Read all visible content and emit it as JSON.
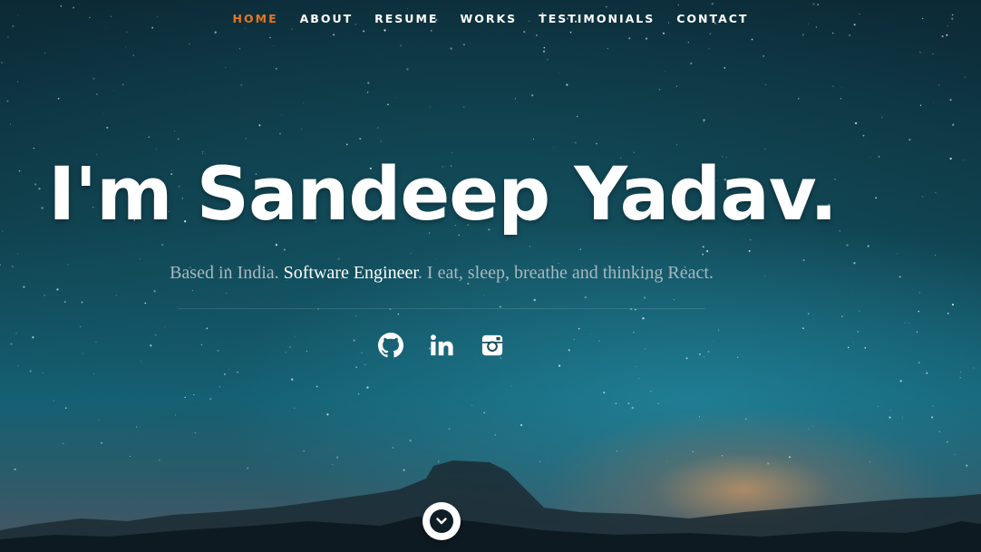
{
  "nav": {
    "items": [
      {
        "label": "HOME",
        "active": true
      },
      {
        "label": "ABOUT",
        "active": false
      },
      {
        "label": "RESUME",
        "active": false
      },
      {
        "label": "WORKS",
        "active": false
      },
      {
        "label": "TESTIMONIALS",
        "active": false
      },
      {
        "label": "CONTACT",
        "active": false
      }
    ],
    "active_color": "#e8741f"
  },
  "hero": {
    "headline": "I'm Sandeep Yadav.",
    "tagline": {
      "prefix": "Based in India. ",
      "highlight": "Software Engineer",
      "suffix": ". I eat, sleep, breathe and thinking React."
    }
  },
  "social": [
    {
      "icon": "github-icon"
    },
    {
      "icon": "linkedin-icon"
    },
    {
      "icon": "instagram-icon"
    }
  ],
  "scroll_button": {
    "icon": "chevron-down-icon"
  }
}
